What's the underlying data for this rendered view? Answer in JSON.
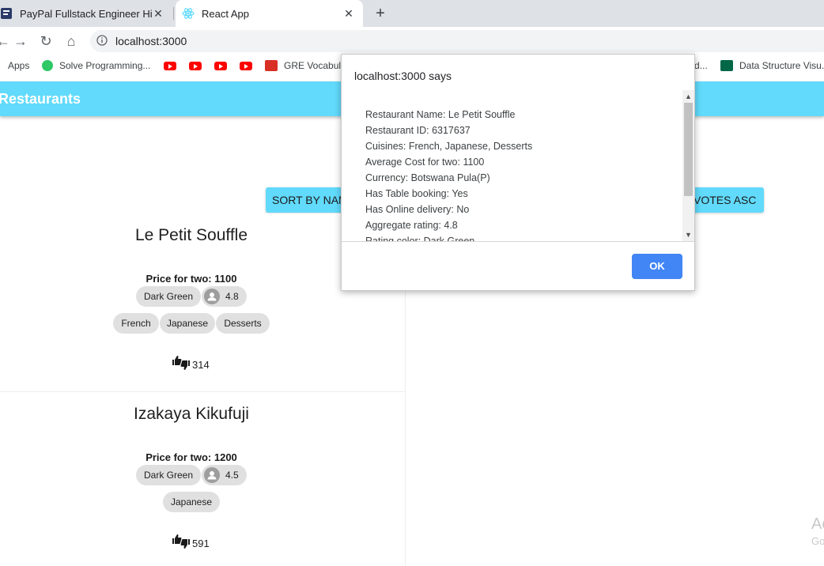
{
  "browser": {
    "tabs": [
      {
        "title": "PayPal Fullstack Engineer Hiring C",
        "active": false
      },
      {
        "title": "React App",
        "active": true
      }
    ],
    "new_tab": "+",
    "url": "localhost:3000",
    "bookmarks": [
      {
        "label": "Apps",
        "icon": "apps-grid-icon"
      },
      {
        "label": "Solve Programming...",
        "icon": "hackerrank-icon"
      },
      {
        "label": "",
        "icon": "youtube-icon"
      },
      {
        "label": "",
        "icon": "youtube-icon"
      },
      {
        "label": "",
        "icon": "youtube-icon"
      },
      {
        "label": "",
        "icon": "youtube-icon"
      },
      {
        "label": "GRE Vocabula",
        "icon": "gre-icon"
      },
      {
        "label": "d...",
        "icon": ""
      },
      {
        "label": "Data Structure Visu...",
        "icon": "usf-icon"
      }
    ]
  },
  "app": {
    "title": "Restaurants",
    "accent": "#61dafb",
    "sort_buttons": [
      "SORT BY NAM",
      "VOTES ASC"
    ]
  },
  "restaurants": [
    {
      "name": "Le Petit Souffle",
      "price": "Price for two: 1100",
      "rating_color": "Dark Green",
      "rating": "4.8",
      "cuisines": [
        "French",
        "Japanese",
        "Desserts"
      ],
      "votes": "314"
    },
    {
      "name": "Izakaya Kikufuji",
      "price": "Price for two: 1200",
      "rating_color": "Dark Green",
      "rating": "4.5",
      "cuisines": [
        "Japanese"
      ],
      "votes": "591"
    }
  ],
  "dialog": {
    "heading": "localhost:3000 says",
    "lines": [
      "Restaurant Name: Le Petit Souffle",
      "Restaurant ID: 6317637",
      "Cuisines: French, Japanese, Desserts",
      "Average Cost for two: 1100",
      "Currency: Botswana Pula(P)",
      "Has Table booking: Yes",
      "Has Online delivery: No",
      "Aggregate rating: 4.8",
      "Rating color: Dark Green"
    ],
    "ok_label": "OK",
    "ok_color": "#4285f4"
  },
  "watermark": {
    "line1": "Ac",
    "line2": "Go"
  }
}
